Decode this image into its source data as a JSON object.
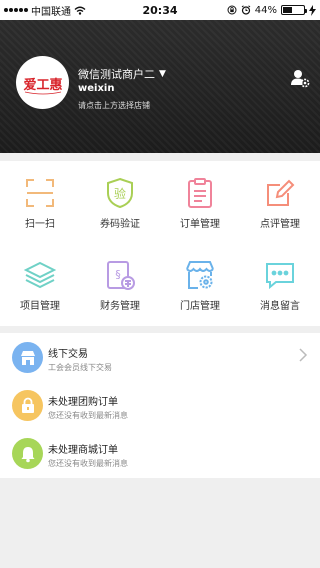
{
  "status_bar": {
    "carrier": "中国联通",
    "time": "20:34",
    "battery_percent": "44%",
    "battery_level": 0.44,
    "icons": [
      "signal-dots",
      "wifi-icon",
      "lock-rotation-icon",
      "alarm-icon",
      "battery-icon",
      "charging-icon"
    ]
  },
  "header": {
    "logo_text": "爱工惠",
    "merchant_name": "微信测试商户二",
    "dropdown_caret": "▼",
    "account": "weixin",
    "hint": "请点击上方选择店铺",
    "settings_icon": "user-settings-icon"
  },
  "grid": [
    {
      "label": "扫一扫",
      "icon": "scan-icon",
      "color": "#f2b97a"
    },
    {
      "label": "券码验证",
      "icon": "coupon-verify-icon",
      "color": "#a9cf55"
    },
    {
      "label": "订单管理",
      "icon": "order-icon",
      "color": "#f0839a"
    },
    {
      "label": "点评管理",
      "icon": "review-edit-icon",
      "color": "#f58e7a"
    },
    {
      "label": "项目管理",
      "icon": "layers-icon",
      "color": "#6fd1c6"
    },
    {
      "label": "财务管理",
      "icon": "finance-icon",
      "color": "#b89be3"
    },
    {
      "label": "门店管理",
      "icon": "store-settings-icon",
      "color": "#6ab2ea"
    },
    {
      "label": "消息留言",
      "icon": "message-icon",
      "color": "#6ad3dc"
    }
  ],
  "list": [
    {
      "title": "线下交易",
      "subtitle": "工会会员线下交易",
      "icon": "store-icon",
      "color": "#7ab3f0",
      "has_arrow": true
    },
    {
      "title": "未处理团购订单",
      "subtitle": "您还没有收到最新消息",
      "icon": "lock-bag-icon",
      "color": "#f6c560",
      "has_arrow": false
    },
    {
      "title": "未处理商城订单",
      "subtitle": "您还没有收到最新消息",
      "icon": "bell-icon",
      "color": "#a7d658",
      "has_arrow": false
    }
  ]
}
